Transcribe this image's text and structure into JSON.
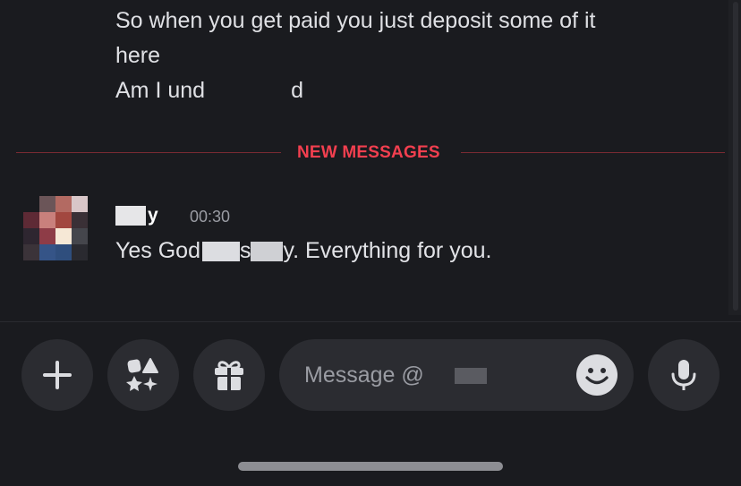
{
  "previous_message": {
    "lines": [
      "So when you get paid you just deposit some  of it",
      "here",
      "Am I und"
    ],
    "trailing_fragment": "d"
  },
  "divider": {
    "label": "NEW MESSAGES"
  },
  "message": {
    "author_visible": "y",
    "timestamp": "00:30",
    "text_parts": [
      "Yes God",
      "s",
      "y. Everything for you."
    ]
  },
  "composer": {
    "placeholder": "Message @",
    "buttons": {
      "add": "plus-icon",
      "apps": "apps-icon",
      "gift": "gift-icon",
      "emoji": "emoji-icon",
      "voice": "microphone-icon"
    }
  },
  "colors": {
    "background": "#1a1b1f",
    "new_messages_red": "#f23f4f",
    "button_bg": "#2b2c31",
    "timestamp": "#9a9ca3"
  }
}
